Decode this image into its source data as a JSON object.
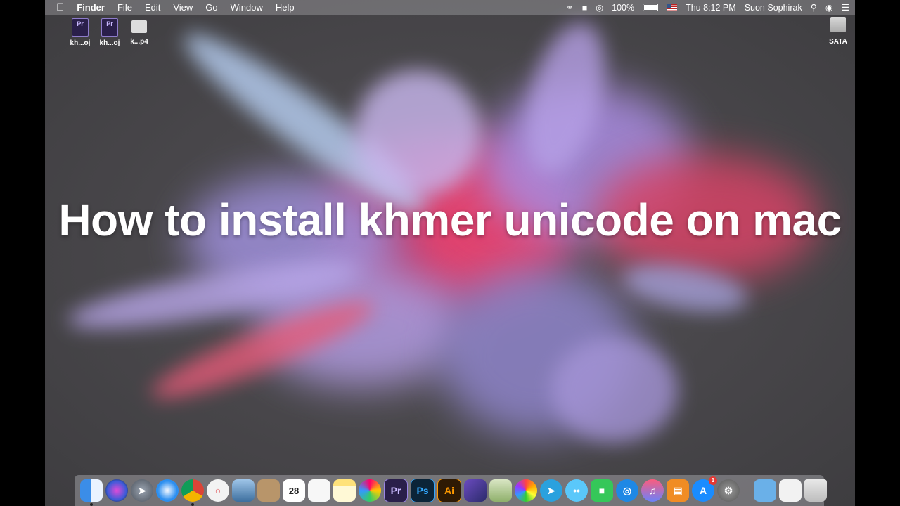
{
  "menubar": {
    "app_name": "Finder",
    "menus": [
      "File",
      "Edit",
      "View",
      "Go",
      "Window",
      "Help"
    ],
    "battery": "100%",
    "clock": "Thu 8:12 PM",
    "user": "Suon Sophirak"
  },
  "desktop": {
    "files": [
      {
        "label": "kh...oj",
        "icon_text": "Pr"
      },
      {
        "label": "kh...oj",
        "icon_text": "Pr"
      },
      {
        "label": "k...p4",
        "icon_text": ""
      }
    ],
    "drive": {
      "label": "SATA"
    }
  },
  "headline": "How to install khmer unicode on mac",
  "dock": {
    "calendar_day": "28",
    "premiere": "Pr",
    "photoshop": "Ps",
    "illustrator": "Ai",
    "appstore_badge": "1"
  }
}
